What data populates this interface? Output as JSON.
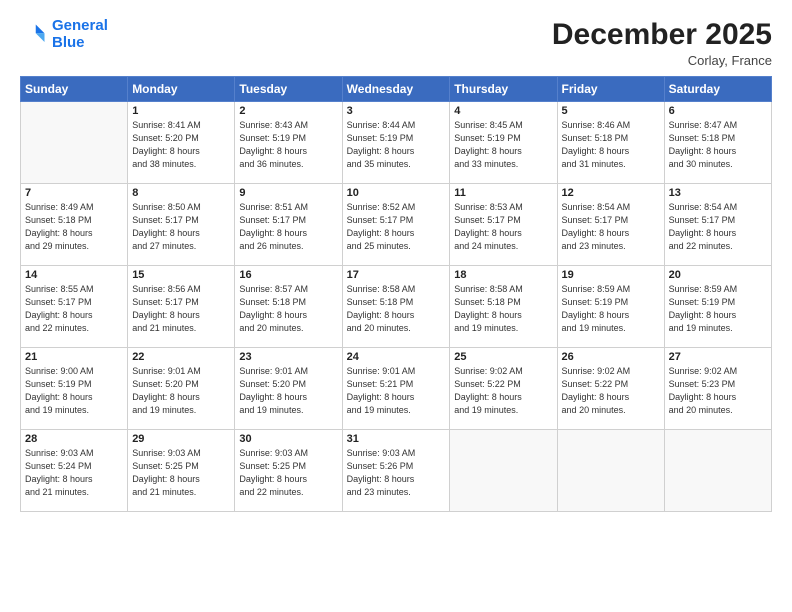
{
  "header": {
    "logo_line1": "General",
    "logo_line2": "Blue",
    "month": "December 2025",
    "location": "Corlay, France"
  },
  "weekdays": [
    "Sunday",
    "Monday",
    "Tuesday",
    "Wednesday",
    "Thursday",
    "Friday",
    "Saturday"
  ],
  "weeks": [
    [
      {
        "day": "",
        "info": ""
      },
      {
        "day": "1",
        "info": "Sunrise: 8:41 AM\nSunset: 5:20 PM\nDaylight: 8 hours\nand 38 minutes."
      },
      {
        "day": "2",
        "info": "Sunrise: 8:43 AM\nSunset: 5:19 PM\nDaylight: 8 hours\nand 36 minutes."
      },
      {
        "day": "3",
        "info": "Sunrise: 8:44 AM\nSunset: 5:19 PM\nDaylight: 8 hours\nand 35 minutes."
      },
      {
        "day": "4",
        "info": "Sunrise: 8:45 AM\nSunset: 5:19 PM\nDaylight: 8 hours\nand 33 minutes."
      },
      {
        "day": "5",
        "info": "Sunrise: 8:46 AM\nSunset: 5:18 PM\nDaylight: 8 hours\nand 31 minutes."
      },
      {
        "day": "6",
        "info": "Sunrise: 8:47 AM\nSunset: 5:18 PM\nDaylight: 8 hours\nand 30 minutes."
      }
    ],
    [
      {
        "day": "7",
        "info": "Sunrise: 8:49 AM\nSunset: 5:18 PM\nDaylight: 8 hours\nand 29 minutes."
      },
      {
        "day": "8",
        "info": "Sunrise: 8:50 AM\nSunset: 5:17 PM\nDaylight: 8 hours\nand 27 minutes."
      },
      {
        "day": "9",
        "info": "Sunrise: 8:51 AM\nSunset: 5:17 PM\nDaylight: 8 hours\nand 26 minutes."
      },
      {
        "day": "10",
        "info": "Sunrise: 8:52 AM\nSunset: 5:17 PM\nDaylight: 8 hours\nand 25 minutes."
      },
      {
        "day": "11",
        "info": "Sunrise: 8:53 AM\nSunset: 5:17 PM\nDaylight: 8 hours\nand 24 minutes."
      },
      {
        "day": "12",
        "info": "Sunrise: 8:54 AM\nSunset: 5:17 PM\nDaylight: 8 hours\nand 23 minutes."
      },
      {
        "day": "13",
        "info": "Sunrise: 8:54 AM\nSunset: 5:17 PM\nDaylight: 8 hours\nand 22 minutes."
      }
    ],
    [
      {
        "day": "14",
        "info": "Sunrise: 8:55 AM\nSunset: 5:17 PM\nDaylight: 8 hours\nand 22 minutes."
      },
      {
        "day": "15",
        "info": "Sunrise: 8:56 AM\nSunset: 5:17 PM\nDaylight: 8 hours\nand 21 minutes."
      },
      {
        "day": "16",
        "info": "Sunrise: 8:57 AM\nSunset: 5:18 PM\nDaylight: 8 hours\nand 20 minutes."
      },
      {
        "day": "17",
        "info": "Sunrise: 8:58 AM\nSunset: 5:18 PM\nDaylight: 8 hours\nand 20 minutes."
      },
      {
        "day": "18",
        "info": "Sunrise: 8:58 AM\nSunset: 5:18 PM\nDaylight: 8 hours\nand 19 minutes."
      },
      {
        "day": "19",
        "info": "Sunrise: 8:59 AM\nSunset: 5:19 PM\nDaylight: 8 hours\nand 19 minutes."
      },
      {
        "day": "20",
        "info": "Sunrise: 8:59 AM\nSunset: 5:19 PM\nDaylight: 8 hours\nand 19 minutes."
      }
    ],
    [
      {
        "day": "21",
        "info": "Sunrise: 9:00 AM\nSunset: 5:19 PM\nDaylight: 8 hours\nand 19 minutes."
      },
      {
        "day": "22",
        "info": "Sunrise: 9:01 AM\nSunset: 5:20 PM\nDaylight: 8 hours\nand 19 minutes."
      },
      {
        "day": "23",
        "info": "Sunrise: 9:01 AM\nSunset: 5:20 PM\nDaylight: 8 hours\nand 19 minutes."
      },
      {
        "day": "24",
        "info": "Sunrise: 9:01 AM\nSunset: 5:21 PM\nDaylight: 8 hours\nand 19 minutes."
      },
      {
        "day": "25",
        "info": "Sunrise: 9:02 AM\nSunset: 5:22 PM\nDaylight: 8 hours\nand 19 minutes."
      },
      {
        "day": "26",
        "info": "Sunrise: 9:02 AM\nSunset: 5:22 PM\nDaylight: 8 hours\nand 20 minutes."
      },
      {
        "day": "27",
        "info": "Sunrise: 9:02 AM\nSunset: 5:23 PM\nDaylight: 8 hours\nand 20 minutes."
      }
    ],
    [
      {
        "day": "28",
        "info": "Sunrise: 9:03 AM\nSunset: 5:24 PM\nDaylight: 8 hours\nand 21 minutes."
      },
      {
        "day": "29",
        "info": "Sunrise: 9:03 AM\nSunset: 5:25 PM\nDaylight: 8 hours\nand 21 minutes."
      },
      {
        "day": "30",
        "info": "Sunrise: 9:03 AM\nSunset: 5:25 PM\nDaylight: 8 hours\nand 22 minutes."
      },
      {
        "day": "31",
        "info": "Sunrise: 9:03 AM\nSunset: 5:26 PM\nDaylight: 8 hours\nand 23 minutes."
      },
      {
        "day": "",
        "info": ""
      },
      {
        "day": "",
        "info": ""
      },
      {
        "day": "",
        "info": ""
      }
    ]
  ]
}
